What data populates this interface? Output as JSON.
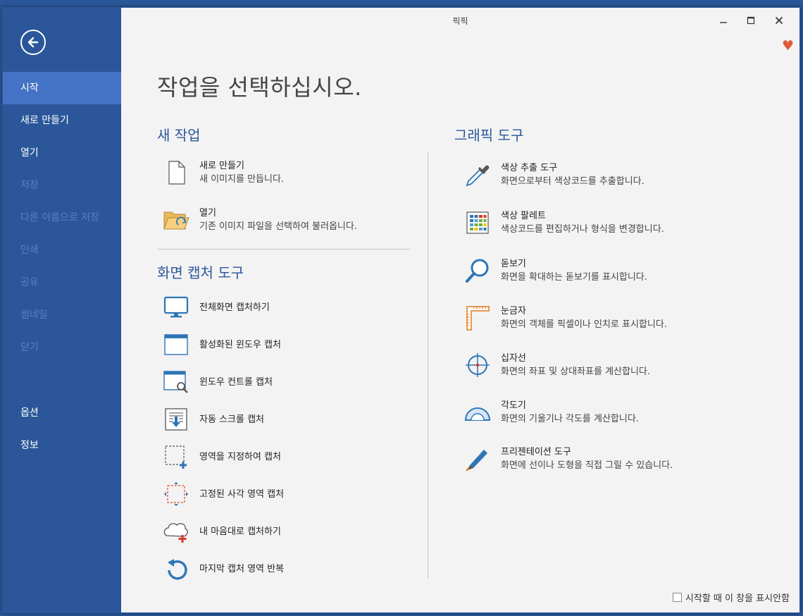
{
  "window": {
    "title": "픽픽"
  },
  "sidebar": {
    "items": [
      {
        "label": "시작",
        "state": "active"
      },
      {
        "label": "새로 만들기",
        "state": "normal"
      },
      {
        "label": "열기",
        "state": "normal"
      },
      {
        "label": "저장",
        "state": "disabled"
      },
      {
        "label": "다른 이름으로 저장",
        "state": "disabled"
      },
      {
        "label": "인쇄",
        "state": "disabled"
      },
      {
        "label": "공유",
        "state": "disabled"
      },
      {
        "label": "썸네일",
        "state": "disabled"
      },
      {
        "label": "닫기",
        "state": "disabled"
      }
    ],
    "bottom_items": [
      {
        "label": "옵션"
      },
      {
        "label": "정보"
      }
    ]
  },
  "main": {
    "title": "작업을 선택하십시오.",
    "new_task": {
      "heading": "새 작업",
      "items": [
        {
          "name": "새로 만들기",
          "desc": "새 이미지를 만듭니다.",
          "icon": "blank-page-icon"
        },
        {
          "name": "열기",
          "desc": "기존 이미지 파일을 선택하여 불러옵니다.",
          "icon": "open-folder-icon"
        }
      ]
    },
    "capture": {
      "heading": "화면 캡처 도구",
      "items": [
        {
          "name": "전체화면 캡처하기",
          "icon": "monitor-icon"
        },
        {
          "name": "활성화된 윈도우 캡처",
          "icon": "window-icon"
        },
        {
          "name": "윈도우 컨트롤 캡처",
          "icon": "window-search-icon"
        },
        {
          "name": "자동 스크롤 캡처",
          "icon": "scroll-capture-icon"
        },
        {
          "name": "영역을 지정하여 캡처",
          "icon": "region-select-icon"
        },
        {
          "name": "고정된 사각 영역 캡처",
          "icon": "fixed-region-icon"
        },
        {
          "name": "내 마음대로 캡처하기",
          "icon": "freehand-capture-icon"
        },
        {
          "name": "마지막 캡처 영역 반복",
          "icon": "repeat-capture-icon"
        }
      ]
    },
    "graphic_tools": {
      "heading": "그래픽 도구",
      "items": [
        {
          "name": "색상 추출 도구",
          "desc": "화면으로부터 색상코드를 추출합니다.",
          "icon": "eyedropper-icon"
        },
        {
          "name": "색상 팔레트",
          "desc": "색상코드를 편집하거나 형식을 변경합니다.",
          "icon": "palette-icon"
        },
        {
          "name": "돋보기",
          "desc": "화면을 확대하는 돋보기를 표시합니다.",
          "icon": "magnifier-icon"
        },
        {
          "name": "눈금자",
          "desc": "화면의 객체를 픽셀이나 인치로 표시합니다.",
          "icon": "ruler-icon"
        },
        {
          "name": "십자선",
          "desc": "화면의 좌표 및 상대좌표를 계산합니다.",
          "icon": "crosshair-icon"
        },
        {
          "name": "각도기",
          "desc": "화면의 기울기나 각도를 계산합니다.",
          "icon": "protractor-icon"
        },
        {
          "name": "프리젠테이션 도구",
          "desc": "화면에 선이나 도형을 직접 그릴 수 있습니다.",
          "icon": "pen-icon"
        }
      ]
    }
  },
  "footer": {
    "checkbox_label": "시작할 때 이 창을 표시안함",
    "checked": false
  },
  "colors": {
    "accent": "#2b579a",
    "active_nav": "#4472c4",
    "disabled_nav": "#5a7fc0",
    "heart": "#e05a3a"
  }
}
